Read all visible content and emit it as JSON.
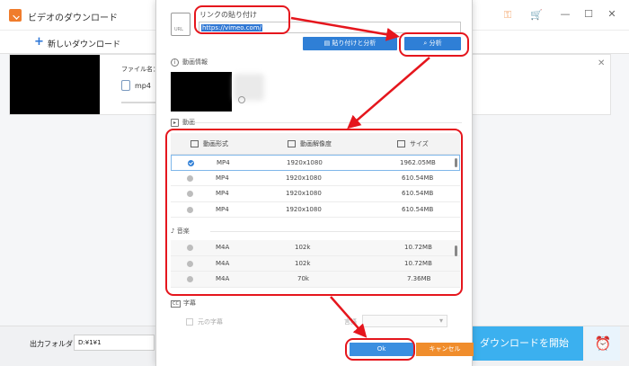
{
  "app": {
    "title": "ビデオのダウンロード",
    "titlebar_icons": [
      "key-icon",
      "cart-icon"
    ],
    "window_controls": [
      "—",
      "☐",
      "✕"
    ],
    "new_download_label": "新しいダウンロード",
    "task": {
      "filename_label": "ファイル名：2",
      "format": "mp4",
      "close": "✕"
    },
    "output_folder_label": "出力フォルダ：",
    "output_folder_value": "D:¥1¥1",
    "start_button": "ダウンロードを開始",
    "accent_color": "#3bb0ef"
  },
  "dialog": {
    "url_icon_text": "URL",
    "url_label": "リンクの貼り付け",
    "url_value": "https://vimeo.com/",
    "paste_analyze_button": "貼り付けと分析",
    "analyze_button": "分析",
    "video_info_title": "動画情報",
    "video_section_title": "動画",
    "video_table": {
      "headers": [
        "動画形式",
        "動画解像度",
        "サイズ"
      ],
      "rows": [
        {
          "format": "MP4",
          "resolution": "1920x1080",
          "size": "1962.05MB",
          "selected": true
        },
        {
          "format": "MP4",
          "resolution": "1920x1080",
          "size": "610.54MB",
          "selected": false
        },
        {
          "format": "MP4",
          "resolution": "1920x1080",
          "size": "610.54MB",
          "selected": false
        },
        {
          "format": "MP4",
          "resolution": "1920x1080",
          "size": "610.54MB",
          "selected": false
        }
      ]
    },
    "audio_section_title": "音楽",
    "audio_table": {
      "rows": [
        {
          "format": "M4A",
          "bitrate": "102k",
          "size": "10.72MB"
        },
        {
          "format": "M4A",
          "bitrate": "102k",
          "size": "10.72MB"
        },
        {
          "format": "M4A",
          "bitrate": "70k",
          "size": "7.36MB"
        }
      ]
    },
    "subtitle_section_title": "字幕",
    "subtitle_original_label": "元の字幕",
    "subtitle_language_label": "言語",
    "ok_button": "Ok",
    "cancel_button": "キャンセル",
    "button_blue": "#2f7fd6",
    "button_orange": "#f08d2c"
  },
  "annotation_color": "#e5161d"
}
